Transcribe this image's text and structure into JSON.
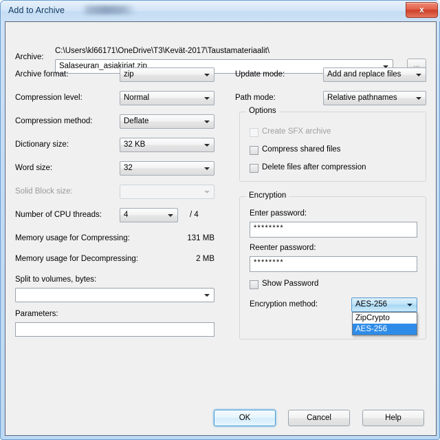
{
  "window": {
    "title": "Add to Archive",
    "close_label": "x",
    "redaction_present": true
  },
  "archive": {
    "label": "Archive:",
    "path_text": "C:\\Users\\kl66171\\OneDrive\\T3\\Kevät-2017\\Taustamateriaalit\\",
    "filename_value": "Salaseuran_asiakirjat.zip",
    "browse_label": "..."
  },
  "left_column": {
    "archive_format": {
      "label": "Archive format:",
      "value": "zip"
    },
    "compression_level": {
      "label": "Compression level:",
      "value": "Normal"
    },
    "compression_method": {
      "label": "Compression method:",
      "value": "Deflate"
    },
    "dictionary_size": {
      "label": "Dictionary size:",
      "value": "32 KB"
    },
    "word_size": {
      "label": "Word size:",
      "value": "32"
    },
    "solid_block_size": {
      "label": "Solid Block size:",
      "value": "",
      "disabled": true
    },
    "cpu_threads": {
      "label": "Number of CPU threads:",
      "value": "4",
      "max_text": "/ 4"
    },
    "memory_compressing": {
      "label": "Memory usage for Compressing:",
      "value": "131 MB"
    },
    "memory_decompressing": {
      "label": "Memory usage for Decompressing:",
      "value": "2 MB"
    },
    "split_volumes": {
      "label": "Split to volumes, bytes:",
      "value": ""
    },
    "parameters": {
      "label": "Parameters:",
      "value": ""
    }
  },
  "right_column": {
    "update_mode": {
      "label": "Update mode:",
      "value": "Add and replace files"
    },
    "path_mode": {
      "label": "Path mode:",
      "value": "Relative pathnames"
    },
    "options": {
      "title": "Options",
      "items": [
        {
          "label": "Create SFX archive",
          "checked": false,
          "disabled": true
        },
        {
          "label": "Compress shared files",
          "checked": false,
          "disabled": false
        },
        {
          "label": "Delete files after compression",
          "checked": false,
          "disabled": false
        }
      ]
    },
    "encryption": {
      "title": "Encryption",
      "enter_password_label": "Enter password:",
      "enter_password_value": "********",
      "reenter_password_label": "Reenter password:",
      "reenter_password_value": "********",
      "show_password": {
        "label": "Show Password",
        "checked": false
      },
      "method_label": "Encryption method:",
      "method_value": "AES-256",
      "method_options": [
        "ZipCrypto",
        "AES-256"
      ],
      "method_selected_index": 1,
      "dropdown_open": true
    }
  },
  "buttons": {
    "ok": "OK",
    "cancel": "Cancel",
    "help": "Help"
  },
  "colors": {
    "dialog_bg": "#f0f0f0",
    "frame_blue": "#bcd8f3",
    "highlight_blue": "#2e8ce8",
    "close_red": "#cf3f27"
  }
}
